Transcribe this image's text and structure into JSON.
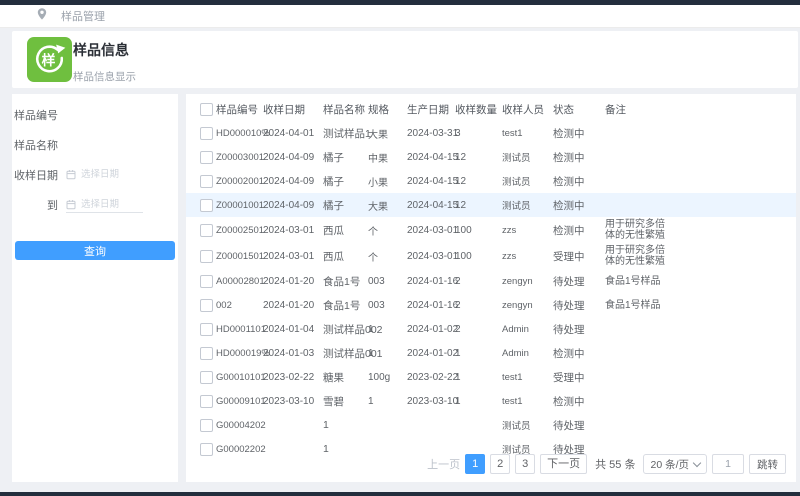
{
  "colors": {
    "accent_blue": "#409eff",
    "brand_green": "#6fbf3f",
    "topbar_dark": "#232e3d",
    "row_highlight": "#ecf5ff"
  },
  "topbar": {
    "breadcrumb": "样品管理"
  },
  "header": {
    "title": "样品信息",
    "subtitle": "样品信息显示",
    "icon_char": "样"
  },
  "filters": {
    "sample_no_label": "样品编号",
    "sample_name_label": "样品名称",
    "date_label": "收样日期",
    "date_to_label": "到",
    "date_placeholder": "选择日期",
    "search_label": "查询"
  },
  "table": {
    "columns": [
      "样品编号",
      "收样日期",
      "样品名称",
      "规格",
      "生产日期",
      "收样数量",
      "收样人员",
      "状态",
      "备注"
    ],
    "rows": [
      {
        "sample_no": "HD000010%",
        "receipt_date": "2024-04-01",
        "name": "测试样品1",
        "spec": "大果",
        "prod_date": "2024-03-31",
        "qty": "3",
        "person": "test1",
        "status": "检测中",
        "remark": ""
      },
      {
        "sample_no": "Z00003001",
        "receipt_date": "2024-04-09",
        "name": "橘子",
        "spec": "中果",
        "prod_date": "2024-04-15",
        "qty": "12",
        "person": "测试员",
        "status": "检测中",
        "remark": ""
      },
      {
        "sample_no": "Z00002001",
        "receipt_date": "2024-04-09",
        "name": "橘子",
        "spec": "小果",
        "prod_date": "2024-04-15",
        "qty": "12",
        "person": "测试员",
        "status": "检测中",
        "remark": ""
      },
      {
        "sample_no": "Z00001001",
        "receipt_date": "2024-04-09",
        "name": "橘子",
        "spec": "大果",
        "prod_date": "2024-04-15",
        "qty": "12",
        "person": "测试员",
        "status": "检测中",
        "remark": "",
        "selected": true
      },
      {
        "sample_no": "Z00002501",
        "receipt_date": "2024-03-01",
        "name": "西瓜",
        "spec": "个",
        "prod_date": "2024-03-01",
        "qty": "100",
        "person": "zzs",
        "status": "检测中",
        "remark": "用于研究多倍体的无性繁殖"
      },
      {
        "sample_no": "Z00001501",
        "receipt_date": "2024-03-01",
        "name": "西瓜",
        "spec": "个",
        "prod_date": "2024-03-01",
        "qty": "100",
        "person": "zzs",
        "status": "受理中",
        "remark": "用于研究多倍体的无性繁殖"
      },
      {
        "sample_no": "A00002801",
        "receipt_date": "2024-01-20",
        "name": "食品1号",
        "spec": "003",
        "prod_date": "2024-01-16",
        "qty": "2",
        "person": "zengyn",
        "status": "待处理",
        "remark": "食品1号样品"
      },
      {
        "sample_no": "002",
        "receipt_date": "2024-01-20",
        "name": "食品1号",
        "spec": "003",
        "prod_date": "2024-01-16",
        "qty": "2",
        "person": "zengyn",
        "status": "待处理",
        "remark": "食品1号样品"
      },
      {
        "sample_no": "HD0001101",
        "receipt_date": "2024-01-04",
        "name": "测试样品002",
        "spec": "1",
        "prod_date": "2024-01-02",
        "qty": "2",
        "person": "Admin",
        "status": "待处理",
        "remark": ""
      },
      {
        "sample_no": "HD000019%",
        "receipt_date": "2024-01-03",
        "name": "测试样品001",
        "spec": "1",
        "prod_date": "2024-01-02",
        "qty": "1",
        "person": "Admin",
        "status": "检测中",
        "remark": ""
      },
      {
        "sample_no": "G00010101",
        "receipt_date": "2023-02-22",
        "name": "糖果",
        "spec": "100g",
        "prod_date": "2023-02-22",
        "qty": "1",
        "person": "test1",
        "status": "受理中",
        "remark": ""
      },
      {
        "sample_no": "G00009101",
        "receipt_date": "2023-03-10",
        "name": "雪碧",
        "spec": "1",
        "prod_date": "2023-03-10",
        "qty": "1",
        "person": "test1",
        "status": "检测中",
        "remark": ""
      },
      {
        "sample_no": "G00004202",
        "receipt_date": "",
        "name": "1",
        "spec": "",
        "prod_date": "",
        "qty": "",
        "person": "测试员",
        "status": "待处理",
        "remark": ""
      },
      {
        "sample_no": "G00002202",
        "receipt_date": "",
        "name": "1",
        "spec": "",
        "prod_date": "",
        "qty": "",
        "person": "测试员",
        "status": "待处理",
        "remark": ""
      }
    ]
  },
  "pagination": {
    "prev_label": "上一页",
    "pages": [
      "1",
      "2",
      "3"
    ],
    "active_page": "1",
    "next_label": "下一页",
    "total_text": "共 55 条",
    "page_size": "20 条/页",
    "jump_value": "1",
    "jump_label": "跳转"
  }
}
